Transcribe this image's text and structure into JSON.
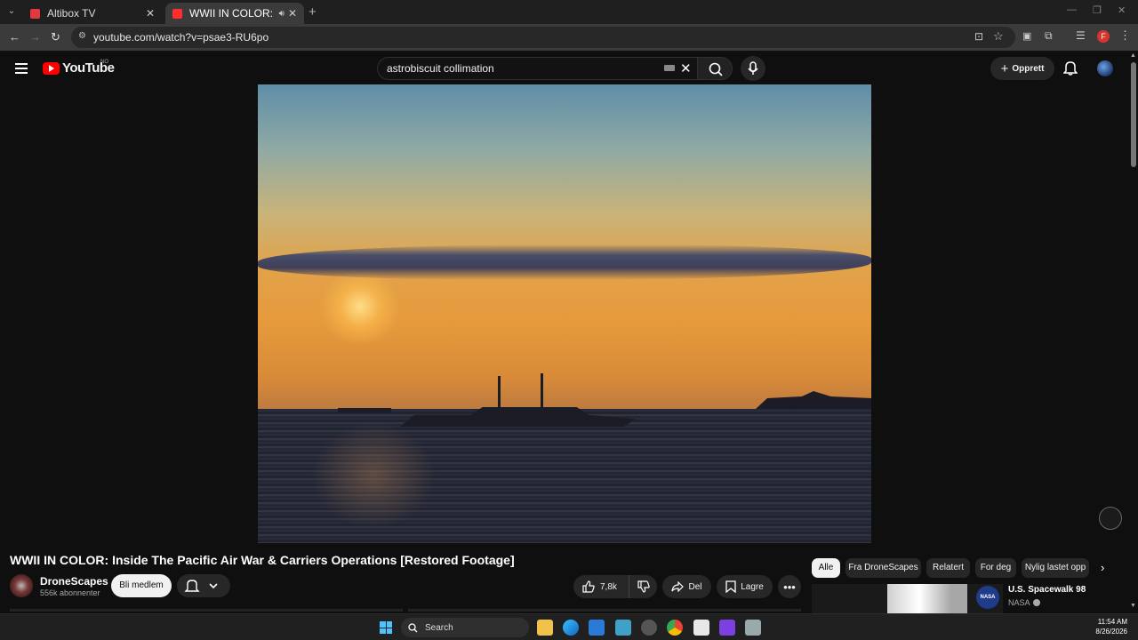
{
  "browser": {
    "tabs": [
      {
        "title": "Altibox TV",
        "active": false
      },
      {
        "title": "WWII IN COLOR: Inside The",
        "active": true
      }
    ],
    "url": "youtube.com/watch?v=psae3-RU6po",
    "profile_initial": "F"
  },
  "youtube": {
    "logo_text": "YouTube",
    "country_code": "NO",
    "search_query": "astrobiscuit collimation",
    "create_label": "Opprett"
  },
  "video": {
    "title": "WWII IN COLOR: Inside The Pacific Air War & Carriers Operations [Restored Footage]",
    "channel": "DroneScapes",
    "subscribers": "556k abonnenter",
    "join_label": "Bli medlem",
    "likes": "7,8k",
    "share_label": "Del",
    "save_label": "Lagre"
  },
  "chips": [
    "Alle",
    "Fra DroneScapes",
    "Relatert",
    "For deg",
    "Nylig lastet opp"
  ],
  "recommendation": {
    "title": "U.S. Spacewalk 98",
    "channel": "NASA",
    "badge": "NASA"
  },
  "taskbar": {
    "search_label": "Search",
    "time": "11:54 AM",
    "date": "8/26/2026"
  },
  "colors": {
    "youtube_red": "#ff0000",
    "background": "#0f0f0f",
    "windows_blue": "#4cc2ff"
  }
}
